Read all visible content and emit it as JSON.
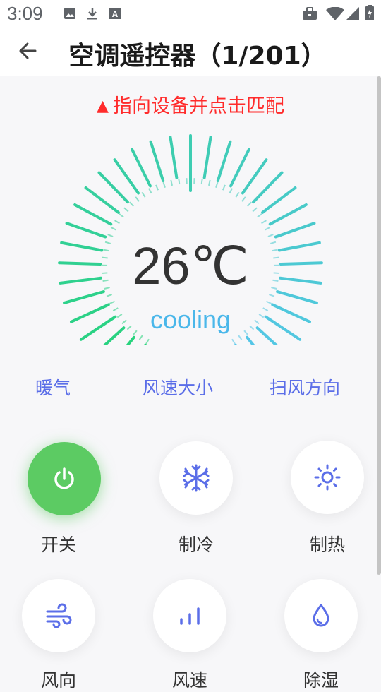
{
  "status_bar": {
    "time": "3:09",
    "left_icons": [
      "image-icon",
      "download-icon",
      "text-a-icon"
    ],
    "right_icons": [
      "briefcase-icon",
      "wifi-icon",
      "signal-icon",
      "battery-charging-icon"
    ]
  },
  "header": {
    "title": "空调遥控器（1/201）",
    "back_icon": "arrow-left-icon"
  },
  "hint": {
    "text": "指向设备并点击匹配",
    "icon": "red-triangle-icon",
    "color": "#ff2b2b"
  },
  "display": {
    "temperature": "26℃",
    "mode": "cooling",
    "gradient_colors": [
      "#26d37a",
      "#56c6ea"
    ]
  },
  "options": [
    {
      "label": "暖气"
    },
    {
      "label": "风速大小"
    },
    {
      "label": "扫风方向"
    }
  ],
  "buttons": [
    {
      "label": "开关",
      "icon": "power-icon",
      "active": true
    },
    {
      "label": "制冷",
      "icon": "snowflake-icon"
    },
    {
      "label": "制热",
      "icon": "sun-icon"
    },
    {
      "label": "风向",
      "icon": "wind-icon"
    },
    {
      "label": "风速",
      "icon": "fan-speed-bars-icon"
    },
    {
      "label": "除湿",
      "icon": "water-drop-icon"
    }
  ],
  "colors": {
    "accent": "#5b6ee8",
    "power": "#5ccb63",
    "mode_text": "#4ab7ea"
  }
}
